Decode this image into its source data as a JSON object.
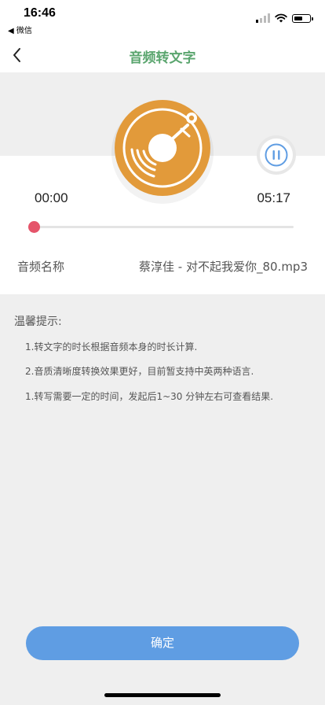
{
  "status_bar": {
    "time": "16:46",
    "back_app": "◀ 微信",
    "wifi_icon": "wifi-icon",
    "battery_icon": "battery-icon",
    "battery_level": 0.55
  },
  "nav": {
    "title": "音频转文字",
    "back_icon": "chevron-left-icon"
  },
  "player": {
    "disc_icon": "vinyl-record-icon",
    "pause_icon": "pause-icon",
    "current_time": "00:00",
    "total_time": "05:17",
    "progress": 0
  },
  "info": {
    "label": "音频名称",
    "value": "蔡淳佳 - 对不起我爱你_80.mp3"
  },
  "tips": {
    "title": "温馨提示:",
    "items": [
      "1.转文字的时长根据音频本身的时长计算.",
      "2.音质清晰度转换效果更好，目前暂支持中英两种语言.",
      "1.转写需要一定的时间，发起后1~30 分钟左右可查看结果."
    ]
  },
  "actions": {
    "confirm_label": "确定"
  },
  "colors": {
    "accent_green": "#5aa56e",
    "disc_orange": "#e29a3a",
    "progress_red": "#e5546a",
    "pause_blue": "#5f9de3",
    "button_blue": "#5f9de3"
  }
}
